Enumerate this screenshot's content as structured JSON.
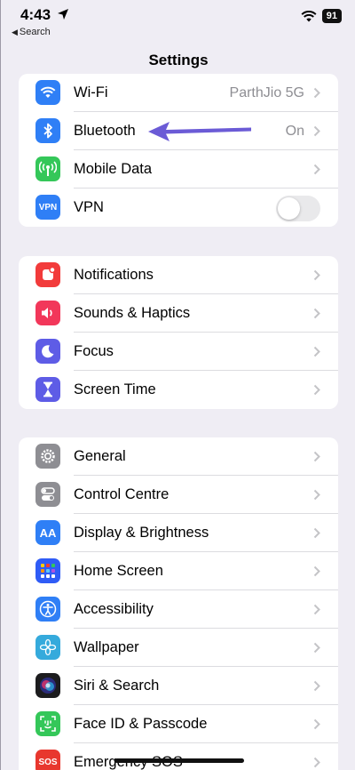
{
  "status": {
    "time": "4:43",
    "back": "Search",
    "battery": "91"
  },
  "nav": {
    "title": "Settings"
  },
  "colors": {
    "arrow": "#6b5bd6",
    "background": "#efedf4"
  },
  "group1": [
    {
      "label": "Wi-Fi",
      "value": "ParthJio 5G",
      "icon": "wifi-icon",
      "color": "#2f7ff6"
    },
    {
      "label": "Bluetooth",
      "value": "On",
      "icon": "bluetooth-icon",
      "color": "#2f7ff6"
    },
    {
      "label": "Mobile Data",
      "value": "",
      "icon": "antenna-icon",
      "color": "#34c759"
    },
    {
      "label": "VPN",
      "value": "",
      "icon": "vpn-icon",
      "color": "#2f7ff6",
      "icon_text": "VPN",
      "toggle": false
    }
  ],
  "group2": [
    {
      "label": "Notifications",
      "icon": "bell-icon",
      "color": "#f23b3b"
    },
    {
      "label": "Sounds & Haptics",
      "icon": "speaker-icon",
      "color": "#f2375a"
    },
    {
      "label": "Focus",
      "icon": "moon-icon",
      "color": "#5e5ce6"
    },
    {
      "label": "Screen Time",
      "icon": "hourglass-icon",
      "color": "#5e5ce6"
    }
  ],
  "group3": [
    {
      "label": "General",
      "icon": "gear-icon",
      "color": "#8e8e93"
    },
    {
      "label": "Control Centre",
      "icon": "switches-icon",
      "color": "#8e8e93"
    },
    {
      "label": "Display & Brightness",
      "icon": "text-size-icon",
      "color": "#2f7ff6",
      "icon_text": "AA"
    },
    {
      "label": "Home Screen",
      "icon": "app-grid-icon",
      "color": "#2f5cf6"
    },
    {
      "label": "Accessibility",
      "icon": "accessibility-icon",
      "color": "#2f7ff6"
    },
    {
      "label": "Wallpaper",
      "icon": "flower-icon",
      "color": "#35aadc"
    },
    {
      "label": "Siri & Search",
      "icon": "siri-icon",
      "color": "#1c1c1e"
    },
    {
      "label": "Face ID & Passcode",
      "icon": "face-id-icon",
      "color": "#34c759"
    },
    {
      "label": "Emergency SOS",
      "icon": "sos-icon",
      "color": "#e8372e",
      "icon_text": "SOS"
    }
  ]
}
